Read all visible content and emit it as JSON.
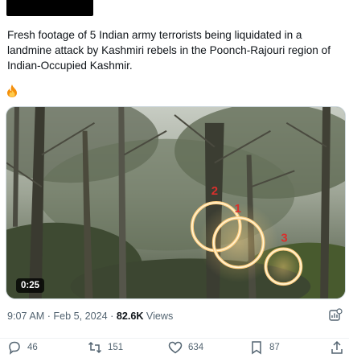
{
  "post": {
    "text": "Fresh footage of 5 Indian army terrorists being liquidated in a landmine attack by Kashmiri rebels in the Poonch-Rajouri region of Indian-Occupied Kashmir.",
    "emoji": "fire-emoji"
  },
  "media": {
    "duration": "0:25",
    "annotations": [
      "2",
      "1",
      "3"
    ]
  },
  "meta": {
    "timestamp": "9:07 AM · Feb 5, 2024 · ",
    "views_count": "82.6K",
    "views_label": " Views"
  },
  "actions": {
    "replies": "46",
    "reposts": "151",
    "likes": "634",
    "bookmarks": "87"
  },
  "colors": {
    "text": "#0f1419",
    "muted": "#536471",
    "ring": "#ffb347"
  }
}
